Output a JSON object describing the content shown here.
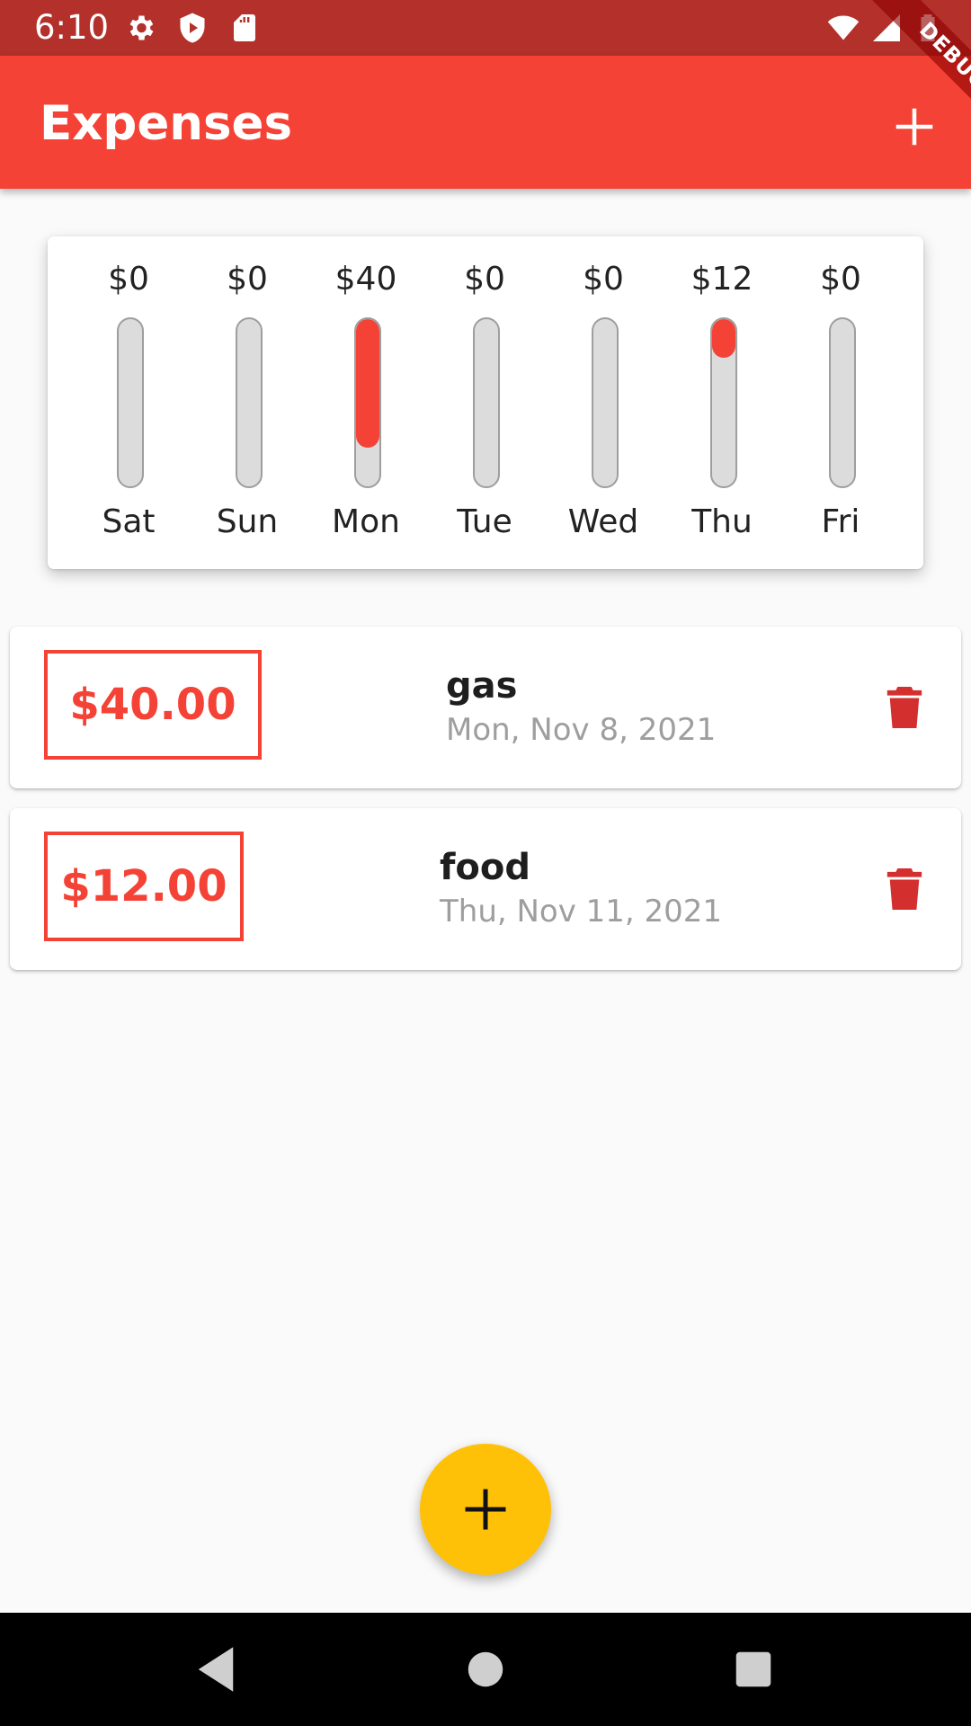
{
  "status_bar": {
    "time": "6:10",
    "left_icons": [
      "settings-icon",
      "shield-play-icon",
      "sd-card-icon"
    ],
    "right_icons": [
      "wifi-icon",
      "signal-icon",
      "battery-icon"
    ]
  },
  "debug_banner": "DEBUG",
  "app_bar": {
    "title": "Expenses",
    "action_icon": "add-icon"
  },
  "chart": {
    "bars": [
      {
        "day": "Sat",
        "amount": "$0",
        "fraction": 0
      },
      {
        "day": "Sun",
        "amount": "$0",
        "fraction": 0
      },
      {
        "day": "Mon",
        "amount": "$40",
        "fraction": 0.769
      },
      {
        "day": "Tue",
        "amount": "$0",
        "fraction": 0
      },
      {
        "day": "Wed",
        "amount": "$0",
        "fraction": 0
      },
      {
        "day": "Thu",
        "amount": "$12",
        "fraction": 0.231
      },
      {
        "day": "Fri",
        "amount": "$0",
        "fraction": 0
      }
    ]
  },
  "transactions": [
    {
      "amount": "$40.00",
      "title": "gas",
      "date": "Mon, Nov 8, 2021",
      "delete_icon": "trash-icon"
    },
    {
      "amount": "$12.00",
      "title": "food",
      "date": "Thu, Nov 11, 2021",
      "delete_icon": "trash-icon"
    }
  ],
  "fab": {
    "icon": "add-icon"
  },
  "nav_bar": {
    "buttons": [
      "back-icon",
      "home-icon",
      "recents-icon"
    ]
  },
  "colors": {
    "primary": "#f44336",
    "status_bar": "#b4302a",
    "accent": "#ffc107",
    "delete": "#d32f2f",
    "secondary_text": "#9e9e9e"
  }
}
